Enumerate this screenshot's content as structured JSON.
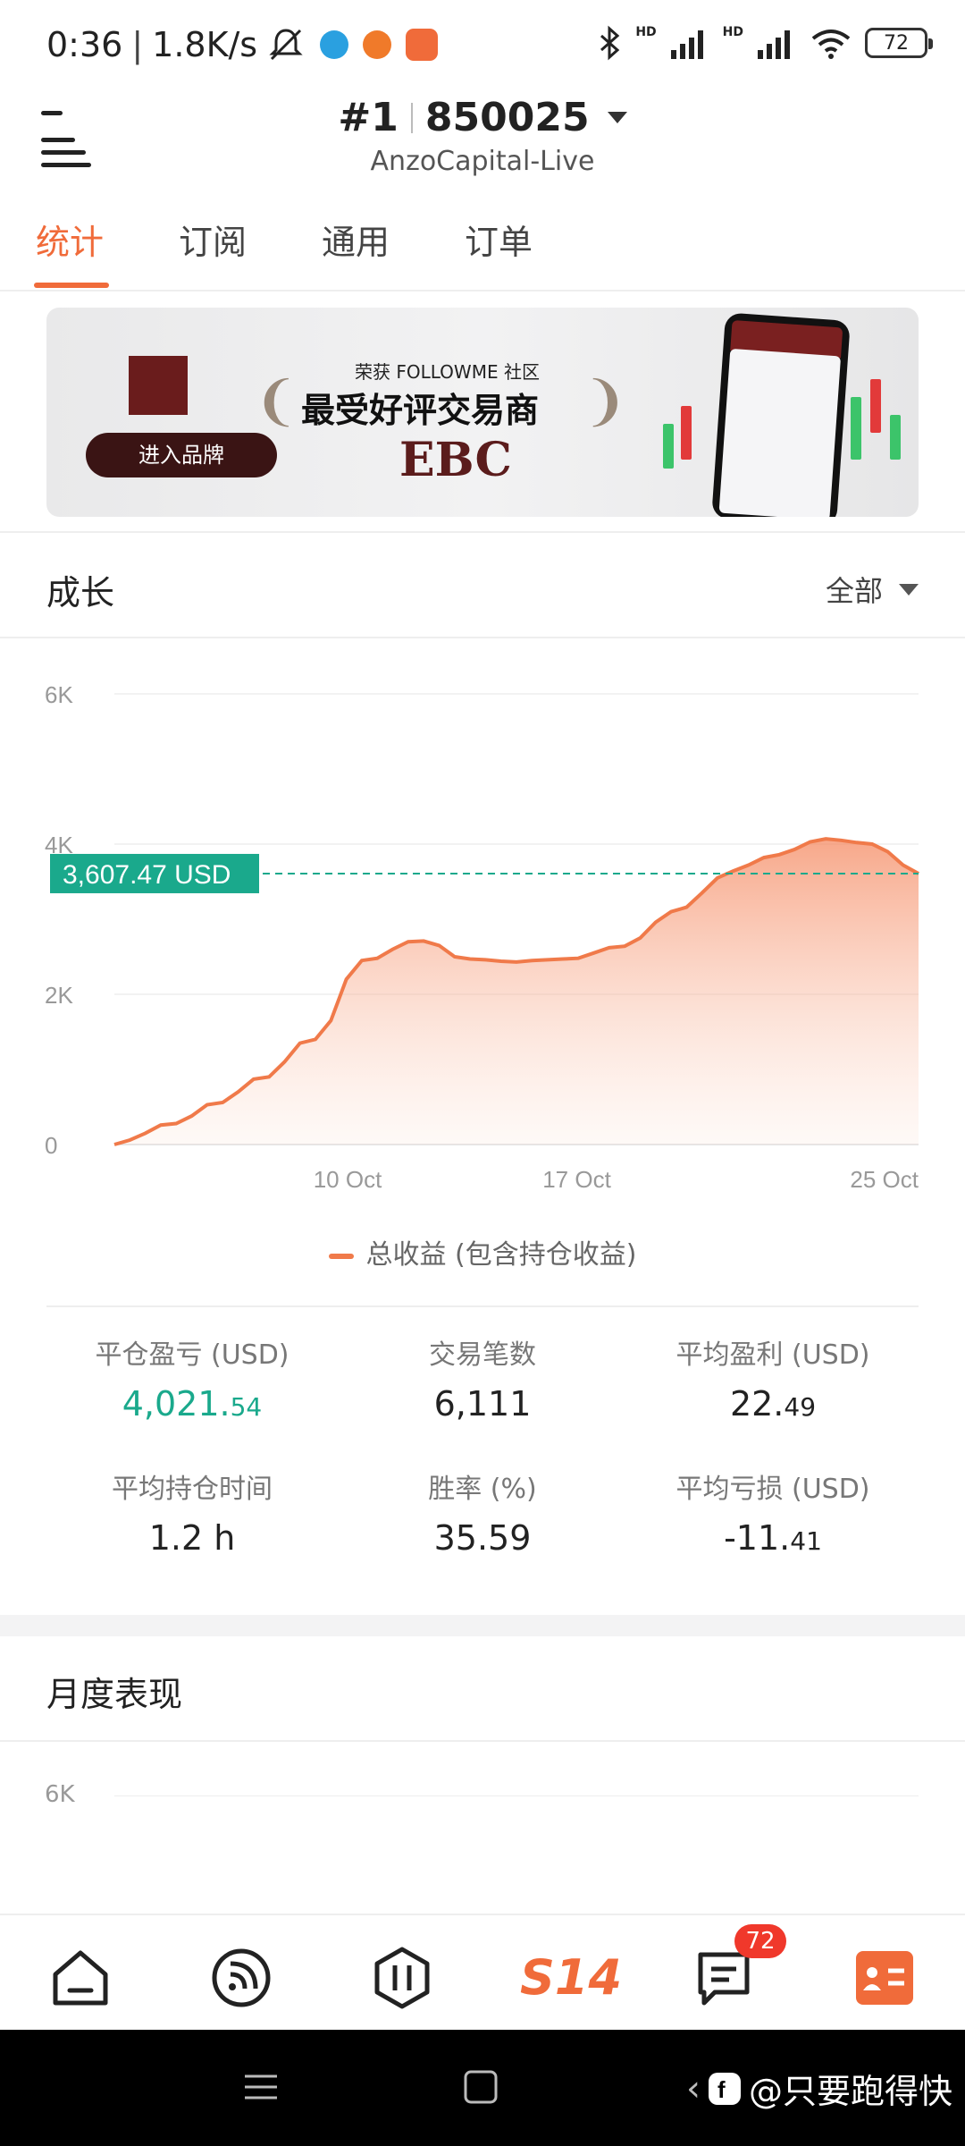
{
  "status_bar": {
    "time": "0:36",
    "net_speed": "1.8K/s",
    "network_1": "HD",
    "network_2": "HD",
    "battery": "72"
  },
  "header": {
    "rank": "#1",
    "account_id": "850025",
    "server": "AnzoCapital-Live"
  },
  "tabs": [
    {
      "label": "统计"
    },
    {
      "label": "订阅"
    },
    {
      "label": "通用"
    },
    {
      "label": "订单"
    }
  ],
  "banner": {
    "button_label": "进入品牌",
    "subtitle": "荣获 FOLLOWME 社区",
    "title": "最受好评交易商",
    "brand": "EBC"
  },
  "growth": {
    "title": "成长",
    "range": "全部",
    "current_value_label": "3,607.47 USD",
    "legend": "总收益 (包含持仓收益)"
  },
  "chart_data": {
    "type": "area",
    "x_tick_labels": [
      "10 Oct",
      "17 Oct",
      "25 Oct"
    ],
    "y_tick_labels": [
      "0",
      "2K",
      "4K",
      "6K"
    ],
    "ylim": [
      0,
      6000
    ],
    "series": [
      {
        "name": "总收益 (包含持仓收益)",
        "values": [
          0,
          60,
          150,
          260,
          280,
          380,
          530,
          560,
          700,
          870,
          900,
          1100,
          1350,
          1400,
          1650,
          2200,
          2450,
          2480,
          2600,
          2700,
          2710,
          2650,
          2500,
          2470,
          2460,
          2440,
          2430,
          2450,
          2460,
          2470,
          2480,
          2550,
          2620,
          2640,
          2750,
          2960,
          3100,
          3160,
          3350,
          3550,
          3640,
          3720,
          3820,
          3860,
          3930,
          4030,
          4070,
          4050,
          4020,
          4000,
          3900,
          3720,
          3607.47
        ]
      }
    ],
    "current_value": 3607.47,
    "grid": true
  },
  "stats": [
    {
      "label": "平仓盈亏 (USD)",
      "value_main": "4,021.",
      "value_dec": "54",
      "positive": true
    },
    {
      "label": "交易笔数",
      "value_main": "6,111",
      "value_dec": ""
    },
    {
      "label": "平均盈利 (USD)",
      "value_main": "22.",
      "value_dec": "49"
    },
    {
      "label": "平均持仓时间",
      "value_main": "1.2 h",
      "value_dec": ""
    },
    {
      "label": "胜率 (%)",
      "value_main": "35.59",
      "value_dec": ""
    },
    {
      "label": "平均亏损 (USD)",
      "value_main": "-11.",
      "value_dec": "41"
    }
  ],
  "monthly": {
    "title": "月度表现",
    "y_tick_top": "6K"
  },
  "bottom_nav": {
    "center_label": "S14",
    "messages_badge": "72"
  },
  "watermark": "@只要跑得快",
  "colors": {
    "accent": "#f06b3a",
    "positive": "#1aa98c",
    "badge": "#f0382b"
  }
}
